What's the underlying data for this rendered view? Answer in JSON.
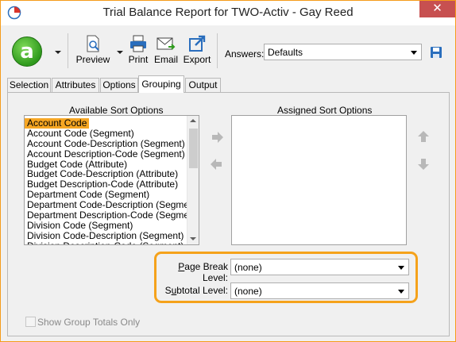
{
  "window": {
    "title": "Trial Balance Report for TWO-Activ - Gay Reed",
    "close_glyph": "✕"
  },
  "toolbar": {
    "logo_letter": "a",
    "preview_label": "Preview",
    "print_label": "Print",
    "email_label": "Email",
    "export_label": "Export",
    "answers_label": "Answers:",
    "answers_value": "Defaults"
  },
  "tabs": [
    {
      "label": "Selection"
    },
    {
      "label": "Attributes"
    },
    {
      "label": "Options"
    },
    {
      "label": "Grouping",
      "active": true
    },
    {
      "label": "Output"
    }
  ],
  "grouping": {
    "available_label": "Available Sort Options",
    "assigned_label": "Assigned Sort Options",
    "available_items": [
      "Account Code",
      "Account Code (Segment)",
      "Account Code-Description (Segment)",
      "Account Description-Code (Segment)",
      "Budget Code (Attribute)",
      "Budget Code-Description (Attribute)",
      "Budget Description-Code (Attribute)",
      "Department Code (Segment)",
      "Department Code-Description (Segment)",
      "Department Description-Code (Segment)",
      "Division Code (Segment)",
      "Division Code-Description (Segment)",
      "Division Description-Code (Segment)"
    ],
    "selected_item": "Account Code",
    "assigned_items": [],
    "page_break_label_pre": "",
    "page_break_label_u": "P",
    "page_break_label_post": "age Break Level:",
    "page_break_value": "(none)",
    "subtotal_label_pre": "S",
    "subtotal_label_u": "u",
    "subtotal_label_post": "btotal Level:",
    "subtotal_value": "(none)",
    "show_group_totals_label": "Show Group Totals Only",
    "show_group_totals_checked": false
  },
  "colors": {
    "accent": "#f5a21b",
    "selection": "#f6a623",
    "close": "#c75050",
    "logo_green": "#2f9a1d"
  }
}
